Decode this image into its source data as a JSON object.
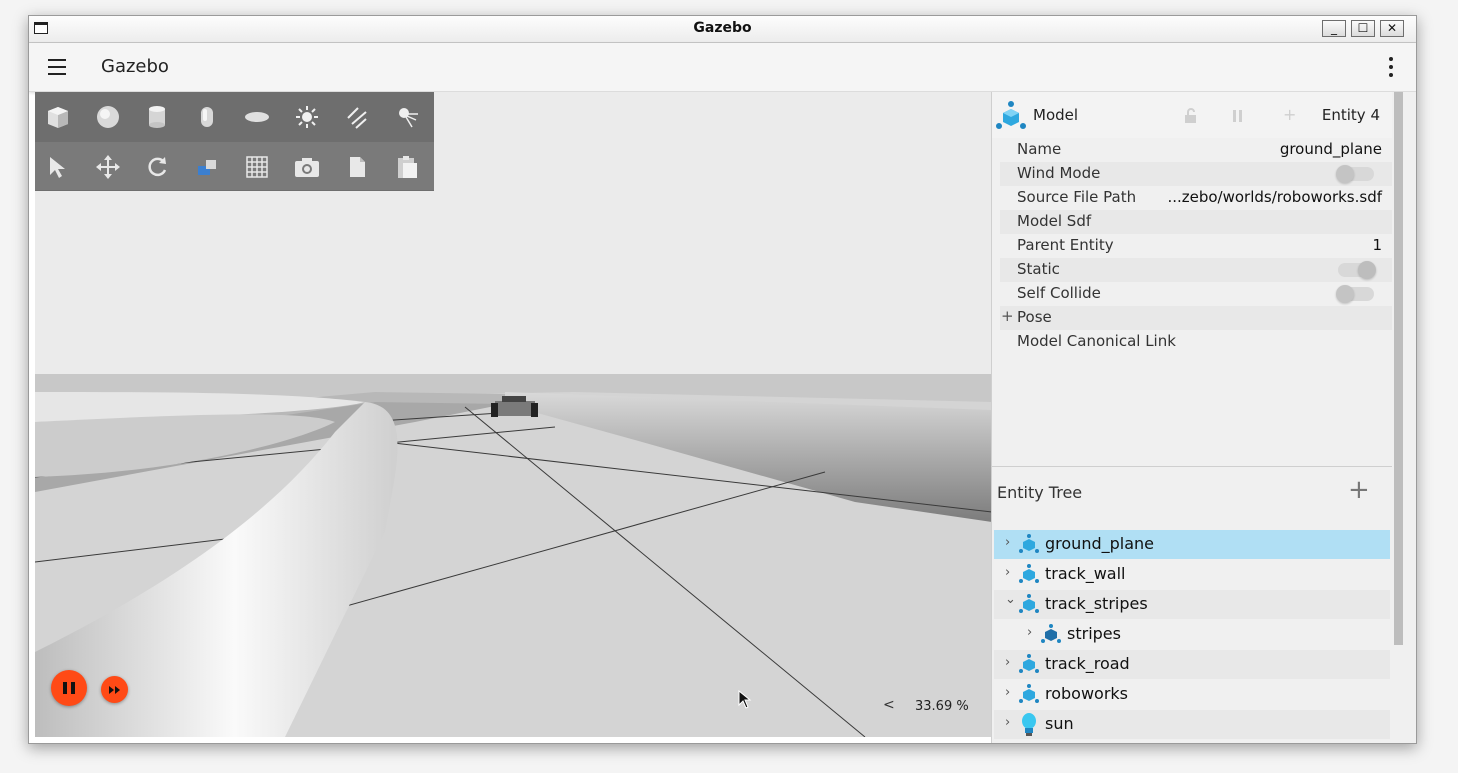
{
  "window": {
    "title": "Gazebo"
  },
  "appbar": {
    "title": "Gazebo"
  },
  "toolbar": {
    "shapes": [
      "box-icon",
      "sphere-icon",
      "cylinder-icon",
      "capsule-icon",
      "ellipsoid-icon",
      "sun-light-icon",
      "directional-light-icon",
      "spot-light-icon"
    ],
    "tools": [
      "select-arrow-icon",
      "translate-icon",
      "rotate-icon",
      "transform-control-icon",
      "grid-icon",
      "camera-icon",
      "copy-icon",
      "paste-icon"
    ]
  },
  "playback": {
    "zoom_readout": "33.69 %",
    "zoom_chevron": "<"
  },
  "component": {
    "kind": "Model",
    "entity": "Entity 4",
    "properties": [
      {
        "label": "Name",
        "value": "ground_plane"
      },
      {
        "label": "Wind Mode",
        "value": ""
      },
      {
        "label": "Source File Path",
        "value": "...zebo/worlds/roboworks.sdf"
      },
      {
        "label": "Model Sdf",
        "value": ""
      },
      {
        "label": "Parent Entity",
        "value": "1"
      },
      {
        "label": "Static",
        "value": ""
      },
      {
        "label": "Self Collide",
        "value": ""
      },
      {
        "label": "Pose",
        "value": "",
        "expand": "+"
      },
      {
        "label": "Model Canonical Link",
        "value": ""
      }
    ],
    "toggles": {
      "wind_mode": false,
      "static": true,
      "self_collide": false
    }
  },
  "entity_tree": {
    "title": "Entity Tree",
    "add": "+",
    "items": [
      {
        "label": "ground_plane",
        "chevron": "›",
        "selected": true
      },
      {
        "label": "track_wall",
        "chevron": "›"
      },
      {
        "label": "track_stripes",
        "chevron": "⌄"
      },
      {
        "label": "stripes",
        "chevron": "›"
      },
      {
        "label": "track_road",
        "chevron": "›"
      },
      {
        "label": "roboworks",
        "chevron": "›"
      },
      {
        "label": "sun",
        "chevron": "›",
        "icon": "bulb-icon"
      }
    ]
  },
  "colors": {
    "accent": "#ff4a16",
    "selection": "#b0dff4",
    "model_icon": "#2ea8df"
  }
}
